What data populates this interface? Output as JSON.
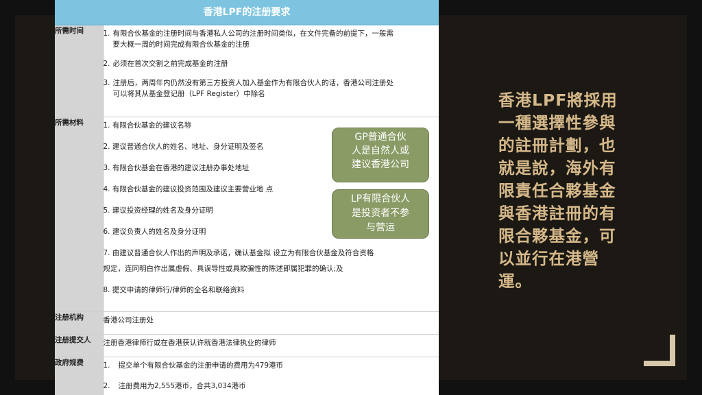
{
  "title": "香港LPF的注册要求",
  "rows": [
    {
      "label": "所需时间",
      "items": [
        {
          "num": "1.",
          "text": "有限合伙基金的注册时间与香港私人公司的注册时间类似，在文件完备的前提下，一般需",
          "cont": "要大概一周的时间完成有限合伙基金的注册"
        },
        {
          "num": "2.",
          "text": "必须在首次交割之前完成基金的注册"
        },
        {
          "num": "3.",
          "text": "注册后，两周年内仍然没有第三方投资人加入基金作为有限合伙人的话，香港公司注册处",
          "cont": "可以将其从基金登记册（LPF Register）中除名"
        }
      ]
    },
    {
      "label": "所需材料",
      "items": [
        {
          "text": "1. 有限合伙基金的建议名称"
        },
        {
          "text": "2. 建议普通合伙人的姓名、地址、身分证明及签名"
        },
        {
          "text": "3. 有限合伙基金在香港的建议注册办事处地址"
        },
        {
          "text": "4. 有限合伙基金的建议投资范围及建议主要营业地 点"
        },
        {
          "text": "5. 建议投资经理的姓名及身分证明"
        },
        {
          "text": "6. 建议负责人的姓名及身分证明"
        },
        {
          "text": "7. 由建议普通合伙人作出的声明及承诺，确认基金拟 设立为有限合伙基金及符合资格",
          "cont": "规定，连同明白作出属虚假、具误导性或具欺骗性的陈述即属犯罪的确认;及"
        },
        {
          "text": "8. 提交申请的律师行/律师的全名和联络资料"
        }
      ]
    },
    {
      "label": "注册机构",
      "text": "香港公司注册处"
    },
    {
      "label": "注册提交人",
      "text": "注册香港律师行或在香港获认许就香港法律执业的律师"
    },
    {
      "label": "政府规费",
      "items": [
        {
          "num": "1.",
          "text": "提交单个有限合伙基金的注册申请的费用为479港币"
        },
        {
          "num": "2.",
          "text": "注册费用为2,555港币，合共3,034港币"
        }
      ]
    }
  ],
  "bubbles": {
    "gp": [
      "GP普通合伙",
      "人是自然人或",
      "建议香港公司"
    ],
    "lp": [
      "LP有限合伙人",
      "是投资者不参",
      "与营运"
    ]
  },
  "side_text": [
    "香港LPF將採用",
    "一種選擇性參與",
    "的註冊計劃，也",
    "就是說，海外有",
    "限責任合夥基金",
    "與香港註冊的有",
    "限合夥基金，可",
    "以並行在港營",
    "運。"
  ]
}
